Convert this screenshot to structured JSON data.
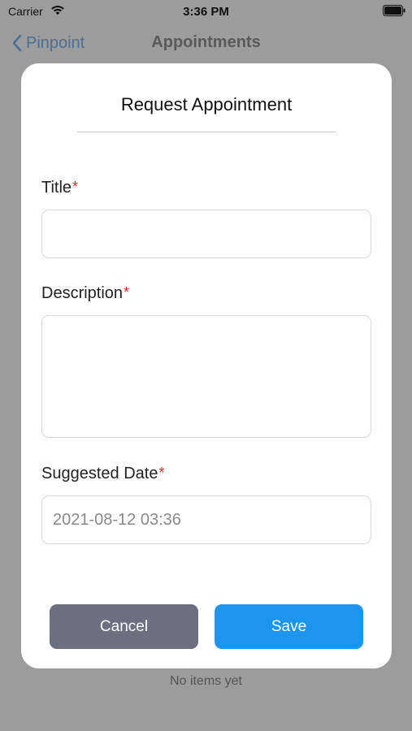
{
  "status_bar": {
    "carrier": "Carrier",
    "time": "3:36 PM",
    "icons": [
      "wifi-icon",
      "battery-icon"
    ]
  },
  "nav": {
    "back_label": "Pinpoint",
    "title": "Appointments"
  },
  "background": {
    "empty_text": "No items yet"
  },
  "modal": {
    "title": "Request Appointment",
    "required_marker": "*",
    "fields": {
      "title": {
        "label": "Title",
        "value": "",
        "placeholder": ""
      },
      "description": {
        "label": "Description",
        "value": "",
        "placeholder": ""
      },
      "suggested_date": {
        "label": "Suggested Date",
        "value": "",
        "placeholder": "2021-08-12 03:36"
      }
    },
    "buttons": {
      "cancel": "Cancel",
      "save": "Save"
    }
  },
  "colors": {
    "overlay_background": "#9c9c9c",
    "back_link": "#4d6f96",
    "required": "#e0302c",
    "cancel_button": "#6b6f7e",
    "save_button": "#1c95ef"
  }
}
